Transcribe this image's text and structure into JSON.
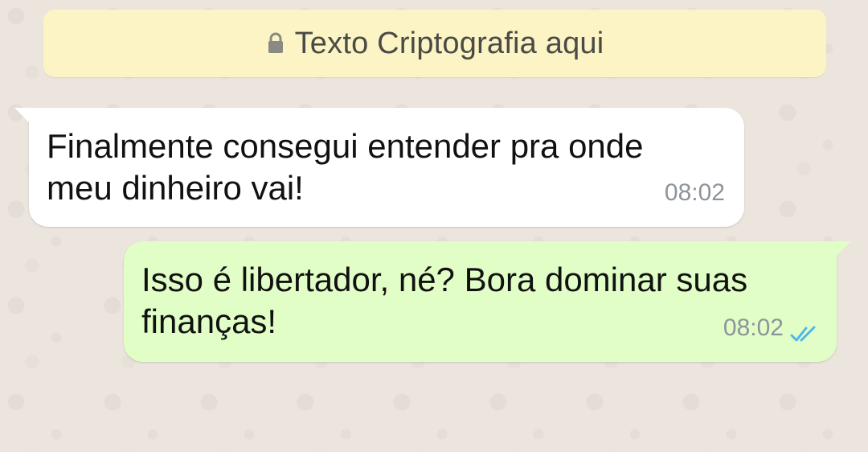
{
  "banner": {
    "icon": "lock-icon",
    "text": "Texto Criptografia aqui"
  },
  "messages": [
    {
      "type": "incoming",
      "text": "Finalmente consegui entender pra onde\nmeu dinheiro vai!",
      "time": "08:02"
    },
    {
      "type": "outgoing",
      "text": "Isso é libertador, né? Bora dominar suas\nfinanças!",
      "time": "08:02",
      "status_icon": "read-double-check-icon"
    }
  ],
  "colors": {
    "background": "#ece5dd",
    "banner": "#fcf4c4",
    "incoming_bubble": "#ffffff",
    "outgoing_bubble": "#e1fec6",
    "read_tick": "#4fb6ec"
  }
}
